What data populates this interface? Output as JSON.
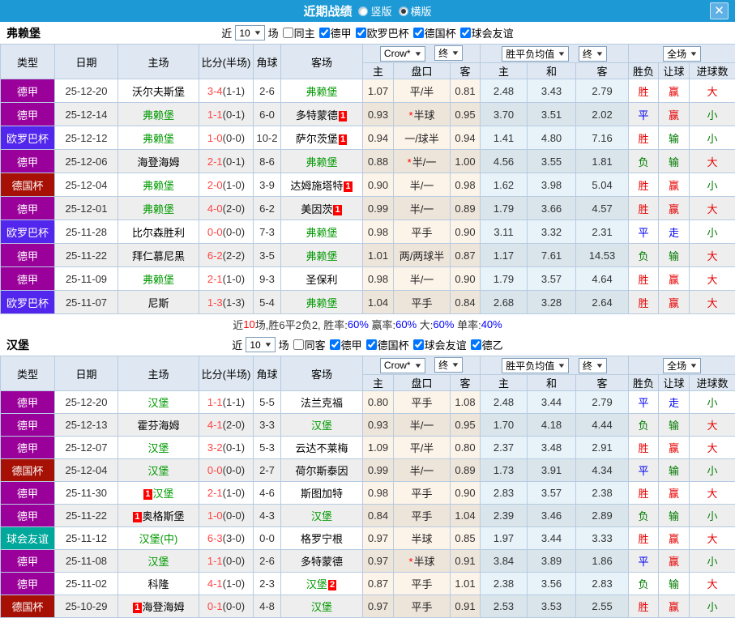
{
  "titlebar": {
    "title": "近期战绩",
    "radio_vertical": "竖版",
    "radio_horizontal": "横版",
    "selected": "横版",
    "close_label": "✕"
  },
  "colors": {
    "titlebar_bg": "#1d9ad5",
    "league": {
      "德甲": "#9a019a",
      "欧罗巴杯": "#5226ec",
      "德国杯": "#a61005",
      "球会友谊": "#00a79b"
    },
    "result": {
      "胜": "#e60000",
      "赢": "#e60000",
      "大": "#e60000",
      "平": "#0000ee",
      "走": "#0000ee",
      "负": "#007a00",
      "输": "#007a00",
      "小": "#007a00"
    }
  },
  "columns": {
    "type": "类型",
    "date": "日期",
    "home": "主场",
    "score": "比分(半场)",
    "corner": "角球",
    "away": "客场",
    "h_home": "主",
    "handicap": "盘口",
    "h_away": "客",
    "e_home": "主",
    "e_draw": "和",
    "e_away": "客",
    "wl": "胜负",
    "hr": "让球",
    "goals": "进球数"
  },
  "dropdowns": {
    "count": "10",
    "crow": "Crow*",
    "final1": "终",
    "avg": "胜平负均值",
    "final2": "终",
    "full": "全场"
  },
  "labels": {
    "near": "近",
    "games": "场"
  },
  "sections": [
    {
      "team": "弗赖堡",
      "same_label": "同主",
      "same_checked": false,
      "leagues": [
        {
          "label": "德甲",
          "checked": true
        },
        {
          "label": "欧罗巴杯",
          "checked": true
        },
        {
          "label": "德国杯",
          "checked": true
        },
        {
          "label": "球会友谊",
          "checked": true
        }
      ],
      "rows": [
        {
          "league": "德甲",
          "date": "25-12-20",
          "home": {
            "name": "沃尔夫斯堡",
            "self": false
          },
          "score": {
            "ft": "3-4",
            "ht": "(1-1)"
          },
          "corner": "2-6",
          "away": {
            "name": "弗赖堡",
            "self": true
          },
          "crow": {
            "home": "1.07",
            "handicap": "平/半",
            "star": false,
            "away": "0.81"
          },
          "europe": {
            "home": "2.48",
            "draw": "3.43",
            "away": "2.79"
          },
          "results": {
            "wl": "胜",
            "hr": "赢",
            "goals": "大"
          }
        },
        {
          "league": "德甲",
          "date": "25-12-14",
          "home": {
            "name": "弗赖堡",
            "self": true
          },
          "score": {
            "ft": "1-1",
            "ht": "(0-1)"
          },
          "corner": "6-0",
          "away": {
            "name": "多特蒙德",
            "self": false,
            "badge_after": "1"
          },
          "crow": {
            "home": "0.93",
            "handicap": "半球",
            "star": true,
            "away": "0.95"
          },
          "europe": {
            "home": "3.70",
            "draw": "3.51",
            "away": "2.02"
          },
          "results": {
            "wl": "平",
            "hr": "赢",
            "goals": "小"
          }
        },
        {
          "league": "欧罗巴杯",
          "date": "25-12-12",
          "home": {
            "name": "弗赖堡",
            "self": true
          },
          "score": {
            "ft": "1-0",
            "ht": "(0-0)"
          },
          "corner": "10-2",
          "away": {
            "name": "萨尔茨堡",
            "self": false,
            "badge_after": "1"
          },
          "crow": {
            "home": "0.94",
            "handicap": "一/球半",
            "star": false,
            "away": "0.94"
          },
          "europe": {
            "home": "1.41",
            "draw": "4.80",
            "away": "7.16"
          },
          "results": {
            "wl": "胜",
            "hr": "输",
            "goals": "小"
          }
        },
        {
          "league": "德甲",
          "date": "25-12-06",
          "home": {
            "name": "海登海姆",
            "self": false
          },
          "score": {
            "ft": "2-1",
            "ht": "(0-1)"
          },
          "corner": "8-6",
          "away": {
            "name": "弗赖堡",
            "self": true
          },
          "crow": {
            "home": "0.88",
            "handicap": "半/一",
            "star": true,
            "away": "1.00"
          },
          "europe": {
            "home": "4.56",
            "draw": "3.55",
            "away": "1.81"
          },
          "results": {
            "wl": "负",
            "hr": "输",
            "goals": "大"
          }
        },
        {
          "league": "德国杯",
          "date": "25-12-04",
          "home": {
            "name": "弗赖堡",
            "self": true
          },
          "score": {
            "ft": "2-0",
            "ht": "(1-0)"
          },
          "corner": "3-9",
          "away": {
            "name": "达姆施塔特",
            "self": false,
            "badge_after": "1"
          },
          "crow": {
            "home": "0.90",
            "handicap": "半/一",
            "star": false,
            "away": "0.98"
          },
          "europe": {
            "home": "1.62",
            "draw": "3.98",
            "away": "5.04"
          },
          "results": {
            "wl": "胜",
            "hr": "赢",
            "goals": "小"
          }
        },
        {
          "league": "德甲",
          "date": "25-12-01",
          "home": {
            "name": "弗赖堡",
            "self": true
          },
          "score": {
            "ft": "4-0",
            "ht": "(2-0)"
          },
          "corner": "6-2",
          "away": {
            "name": "美因茨",
            "self": false,
            "badge_after": "1"
          },
          "crow": {
            "home": "0.99",
            "handicap": "半/一",
            "star": false,
            "away": "0.89"
          },
          "europe": {
            "home": "1.79",
            "draw": "3.66",
            "away": "4.57"
          },
          "results": {
            "wl": "胜",
            "hr": "赢",
            "goals": "大"
          }
        },
        {
          "league": "欧罗巴杯",
          "date": "25-11-28",
          "home": {
            "name": "比尔森胜利",
            "self": false
          },
          "score": {
            "ft": "0-0",
            "ht": "(0-0)"
          },
          "corner": "7-3",
          "away": {
            "name": "弗赖堡",
            "self": true
          },
          "crow": {
            "home": "0.98",
            "handicap": "平手",
            "star": false,
            "away": "0.90"
          },
          "europe": {
            "home": "3.11",
            "draw": "3.32",
            "away": "2.31"
          },
          "results": {
            "wl": "平",
            "hr": "走",
            "goals": "小"
          }
        },
        {
          "league": "德甲",
          "date": "25-11-22",
          "home": {
            "name": "拜仁慕尼黑",
            "self": false
          },
          "score": {
            "ft": "6-2",
            "ht": "(2-2)"
          },
          "corner": "3-5",
          "away": {
            "name": "弗赖堡",
            "self": true
          },
          "crow": {
            "home": "1.01",
            "handicap": "两/两球半",
            "star": false,
            "away": "0.87"
          },
          "europe": {
            "home": "1.17",
            "draw": "7.61",
            "away": "14.53"
          },
          "results": {
            "wl": "负",
            "hr": "输",
            "goals": "大"
          }
        },
        {
          "league": "德甲",
          "date": "25-11-09",
          "home": {
            "name": "弗赖堡",
            "self": true
          },
          "score": {
            "ft": "2-1",
            "ht": "(1-0)"
          },
          "corner": "9-3",
          "away": {
            "name": "圣保利",
            "self": false
          },
          "crow": {
            "home": "0.98",
            "handicap": "半/一",
            "star": false,
            "away": "0.90"
          },
          "europe": {
            "home": "1.79",
            "draw": "3.57",
            "away": "4.64"
          },
          "results": {
            "wl": "胜",
            "hr": "赢",
            "goals": "大"
          }
        },
        {
          "league": "欧罗巴杯",
          "date": "25-11-07",
          "home": {
            "name": "尼斯",
            "self": false
          },
          "score": {
            "ft": "1-3",
            "ht": "(1-3)"
          },
          "corner": "5-4",
          "away": {
            "name": "弗赖堡",
            "self": true
          },
          "crow": {
            "home": "1.04",
            "handicap": "平手",
            "star": false,
            "away": "0.84"
          },
          "europe": {
            "home": "2.68",
            "draw": "3.28",
            "away": "2.64"
          },
          "results": {
            "wl": "胜",
            "hr": "赢",
            "goals": "大"
          }
        }
      ],
      "summary": [
        {
          "t": "近",
          "c": "k"
        },
        {
          "t": "10",
          "c": "r"
        },
        {
          "t": "场,胜6平2负2, 胜率:",
          "c": "k"
        },
        {
          "t": "60%",
          "c": "b"
        },
        {
          "t": " 赢率:",
          "c": "k"
        },
        {
          "t": "60%",
          "c": "b"
        },
        {
          "t": " 大:",
          "c": "k"
        },
        {
          "t": "60%",
          "c": "b"
        },
        {
          "t": " 单率:",
          "c": "k"
        },
        {
          "t": "40%",
          "c": "b"
        }
      ]
    },
    {
      "team": "汉堡",
      "same_label": "同客",
      "same_checked": false,
      "leagues": [
        {
          "label": "德甲",
          "checked": true
        },
        {
          "label": "德国杯",
          "checked": true
        },
        {
          "label": "球会友谊",
          "checked": true
        },
        {
          "label": "德乙",
          "checked": true
        }
      ],
      "rows": [
        {
          "league": "德甲",
          "date": "25-12-20",
          "home": {
            "name": "汉堡",
            "self": true
          },
          "score": {
            "ft": "1-1",
            "ht": "(1-1)"
          },
          "corner": "5-5",
          "away": {
            "name": "法兰克福",
            "self": false
          },
          "crow": {
            "home": "0.80",
            "handicap": "平手",
            "star": false,
            "away": "1.08"
          },
          "europe": {
            "home": "2.48",
            "draw": "3.44",
            "away": "2.79"
          },
          "results": {
            "wl": "平",
            "hr": "走",
            "goals": "小"
          }
        },
        {
          "league": "德甲",
          "date": "25-12-13",
          "home": {
            "name": "霍芬海姆",
            "self": false
          },
          "score": {
            "ft": "4-1",
            "ht": "(2-0)"
          },
          "corner": "3-3",
          "away": {
            "name": "汉堡",
            "self": true
          },
          "crow": {
            "home": "0.93",
            "handicap": "半/一",
            "star": false,
            "away": "0.95"
          },
          "europe": {
            "home": "1.70",
            "draw": "4.18",
            "away": "4.44"
          },
          "results": {
            "wl": "负",
            "hr": "输",
            "goals": "大"
          }
        },
        {
          "league": "德甲",
          "date": "25-12-07",
          "home": {
            "name": "汉堡",
            "self": true
          },
          "score": {
            "ft": "3-2",
            "ht": "(0-1)"
          },
          "corner": "5-3",
          "away": {
            "name": "云达不莱梅",
            "self": false
          },
          "crow": {
            "home": "1.09",
            "handicap": "平/半",
            "star": false,
            "away": "0.80"
          },
          "europe": {
            "home": "2.37",
            "draw": "3.48",
            "away": "2.91"
          },
          "results": {
            "wl": "胜",
            "hr": "赢",
            "goals": "大"
          }
        },
        {
          "league": "德国杯",
          "date": "25-12-04",
          "home": {
            "name": "汉堡",
            "self": true
          },
          "score": {
            "ft": "0-0",
            "ht": "(0-0)"
          },
          "corner": "2-7",
          "away": {
            "name": "荷尔斯泰因",
            "self": false
          },
          "crow": {
            "home": "0.99",
            "handicap": "半/一",
            "star": false,
            "away": "0.89"
          },
          "europe": {
            "home": "1.73",
            "draw": "3.91",
            "away": "4.34"
          },
          "results": {
            "wl": "平",
            "hr": "输",
            "goals": "小"
          }
        },
        {
          "league": "德甲",
          "date": "25-11-30",
          "home": {
            "name": "汉堡",
            "self": true,
            "badge_before": "1"
          },
          "score": {
            "ft": "2-1",
            "ht": "(1-0)"
          },
          "corner": "4-6",
          "away": {
            "name": "斯图加特",
            "self": false
          },
          "crow": {
            "home": "0.98",
            "handicap": "平手",
            "star": false,
            "away": "0.90"
          },
          "europe": {
            "home": "2.83",
            "draw": "3.57",
            "away": "2.38"
          },
          "results": {
            "wl": "胜",
            "hr": "赢",
            "goals": "大"
          }
        },
        {
          "league": "德甲",
          "date": "25-11-22",
          "home": {
            "name": "奥格斯堡",
            "self": false,
            "badge_before": "1"
          },
          "score": {
            "ft": "1-0",
            "ht": "(0-0)"
          },
          "corner": "4-3",
          "away": {
            "name": "汉堡",
            "self": true
          },
          "crow": {
            "home": "0.84",
            "handicap": "平手",
            "star": false,
            "away": "1.04"
          },
          "europe": {
            "home": "2.39",
            "draw": "3.46",
            "away": "2.89"
          },
          "results": {
            "wl": "负",
            "hr": "输",
            "goals": "小"
          }
        },
        {
          "league": "球会友谊",
          "date": "25-11-12",
          "home": {
            "name": "汉堡(中)",
            "self": true
          },
          "score": {
            "ft": "6-3",
            "ht": "(3-0)"
          },
          "corner": "0-0",
          "away": {
            "name": "格罗宁根",
            "self": false
          },
          "crow": {
            "home": "0.97",
            "handicap": "半球",
            "star": false,
            "away": "0.85"
          },
          "europe": {
            "home": "1.97",
            "draw": "3.44",
            "away": "3.33"
          },
          "results": {
            "wl": "胜",
            "hr": "赢",
            "goals": "大"
          }
        },
        {
          "league": "德甲",
          "date": "25-11-08",
          "home": {
            "name": "汉堡",
            "self": true
          },
          "score": {
            "ft": "1-1",
            "ht": "(0-0)"
          },
          "corner": "2-6",
          "away": {
            "name": "多特蒙德",
            "self": false
          },
          "crow": {
            "home": "0.97",
            "handicap": "半球",
            "star": true,
            "away": "0.91"
          },
          "europe": {
            "home": "3.84",
            "draw": "3.89",
            "away": "1.86"
          },
          "results": {
            "wl": "平",
            "hr": "赢",
            "goals": "小"
          }
        },
        {
          "league": "德甲",
          "date": "25-11-02",
          "home": {
            "name": "科隆",
            "self": false
          },
          "score": {
            "ft": "4-1",
            "ht": "(1-0)"
          },
          "corner": "2-3",
          "away": {
            "name": "汉堡",
            "self": true,
            "badge_after": "2"
          },
          "crow": {
            "home": "0.87",
            "handicap": "平手",
            "star": false,
            "away": "1.01"
          },
          "europe": {
            "home": "2.38",
            "draw": "3.56",
            "away": "2.83"
          },
          "results": {
            "wl": "负",
            "hr": "输",
            "goals": "大"
          }
        },
        {
          "league": "德国杯",
          "date": "25-10-29",
          "home": {
            "name": "海登海姆",
            "self": false,
            "badge_before": "1"
          },
          "score": {
            "ft": "0-1",
            "ht": "(0-0)"
          },
          "corner": "4-8",
          "away": {
            "name": "汉堡",
            "self": true
          },
          "crow": {
            "home": "0.97",
            "handicap": "平手",
            "star": false,
            "away": "0.91"
          },
          "europe": {
            "home": "2.53",
            "draw": "3.53",
            "away": "2.55"
          },
          "results": {
            "wl": "胜",
            "hr": "赢",
            "goals": "小"
          }
        }
      ],
      "summary": null
    }
  ]
}
